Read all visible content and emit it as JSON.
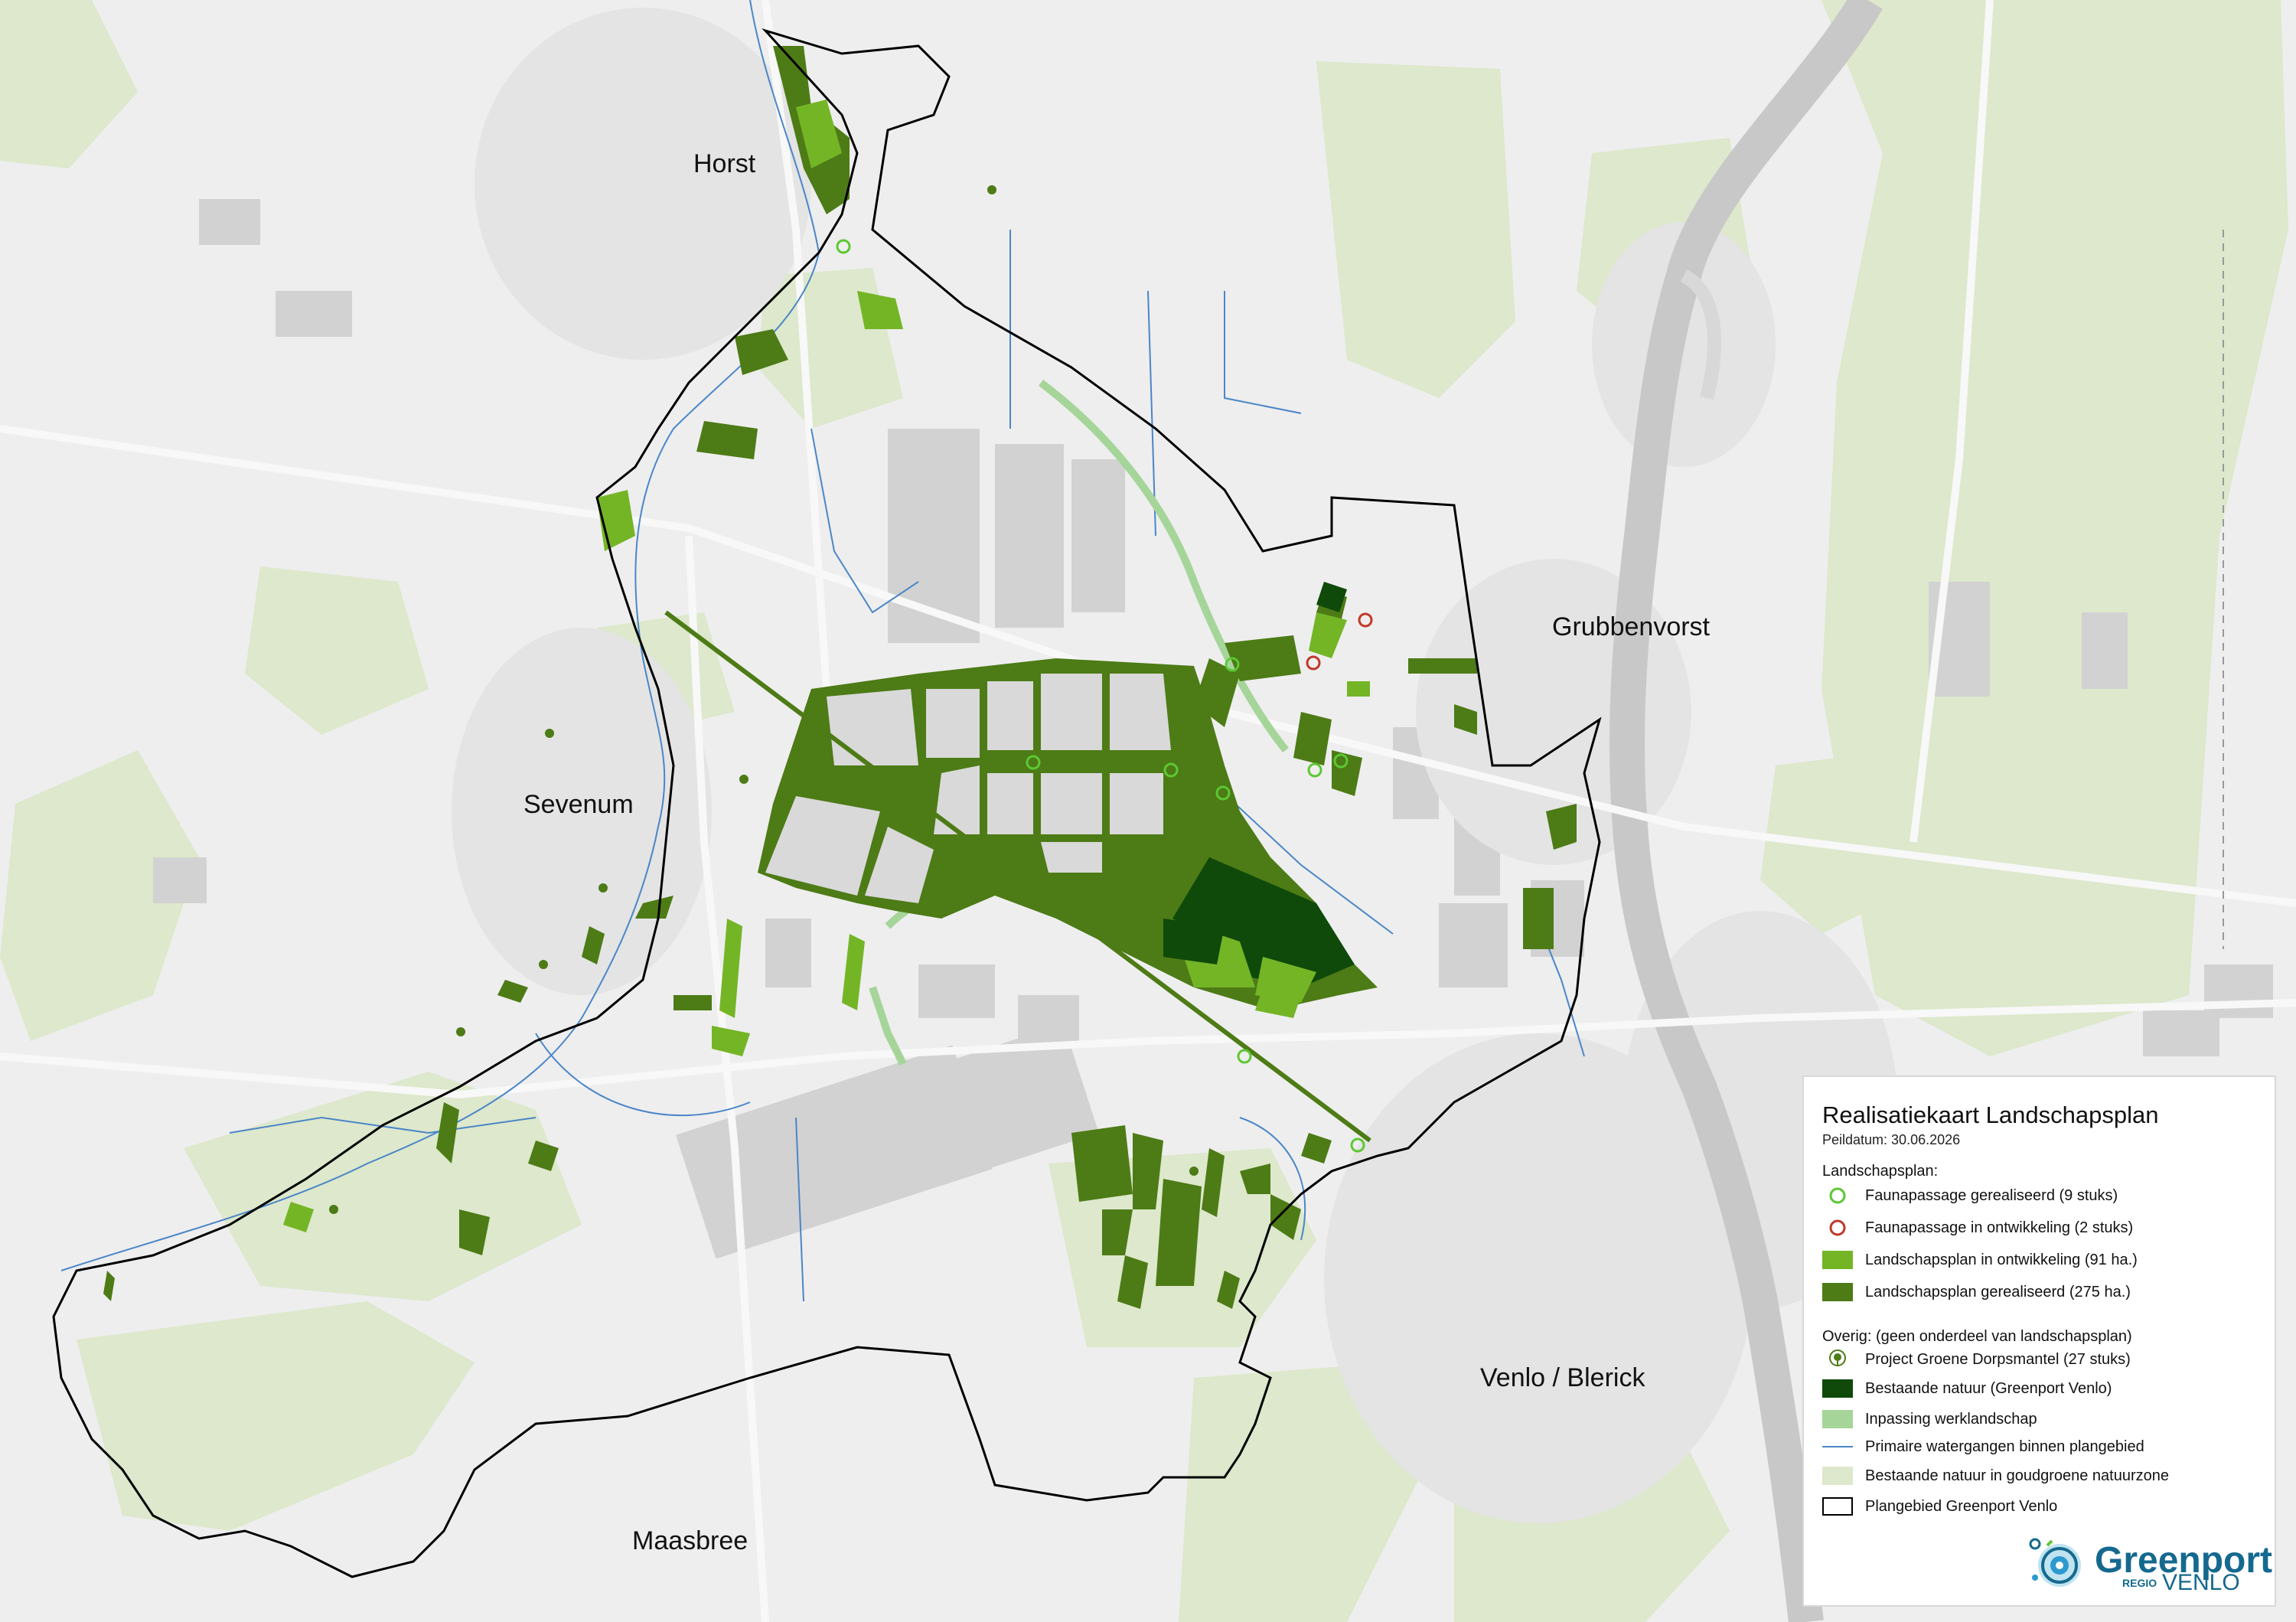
{
  "places": {
    "horst": "Horst",
    "grubbenvorst": "Grubbenvorst",
    "sevenum": "Sevenum",
    "venlo_blerick": "Venlo / Blerick",
    "maasbree": "Maasbree"
  },
  "legend": {
    "title": "Realisatiekaart Landschapsplan",
    "date": "Peildatum: 30.06.2026",
    "section1": "Landschapsplan:",
    "section2": "Overig: (geen onderdeel van landschapsplan)",
    "items1": [
      {
        "label": "Faunapassage gerealiseerd (9 stuks)",
        "icon": "green-circle-icon",
        "color": "#5cc833"
      },
      {
        "label": "Faunapassage in ontwikkeling (2 stuks)",
        "icon": "red-circle-icon",
        "color": "#c0392b"
      },
      {
        "label": "Landschapsplan in ontwikkeling  (91 ha.)",
        "icon": "light-green-patch-icon",
        "color": "#74b526"
      },
      {
        "label": "Landschapsplan gerealiseerd (275 ha.)",
        "icon": "green-patch-icon",
        "color": "#4d7b16"
      }
    ],
    "items2": [
      {
        "label": "Project Groene Dorpsmantel (27 stuks)",
        "icon": "tree-icon",
        "color": "#4d7b16"
      },
      {
        "label": "Bestaande natuur (Greenport Venlo)",
        "icon": "dark-green-patch-icon",
        "color": "#0f4a0a"
      },
      {
        "label": "Inpassing werklandschap",
        "icon": "pale-green-patch-icon",
        "color": "#a6d59a"
      },
      {
        "label": "Primaire watergangen binnen plangebied",
        "icon": "blue-line-icon",
        "color": "#4a86c8"
      },
      {
        "label": "Bestaande natuur in goudgroene natuurzone",
        "icon": "beige-patch-icon",
        "color": "#dde8cc"
      },
      {
        "label": "Plangebied Greenport Venlo",
        "icon": "black-outline-icon",
        "color": "#000000"
      }
    ]
  },
  "logo": {
    "word": "Greenport",
    "regio": "REGIO",
    "venlo": "VENLO"
  }
}
